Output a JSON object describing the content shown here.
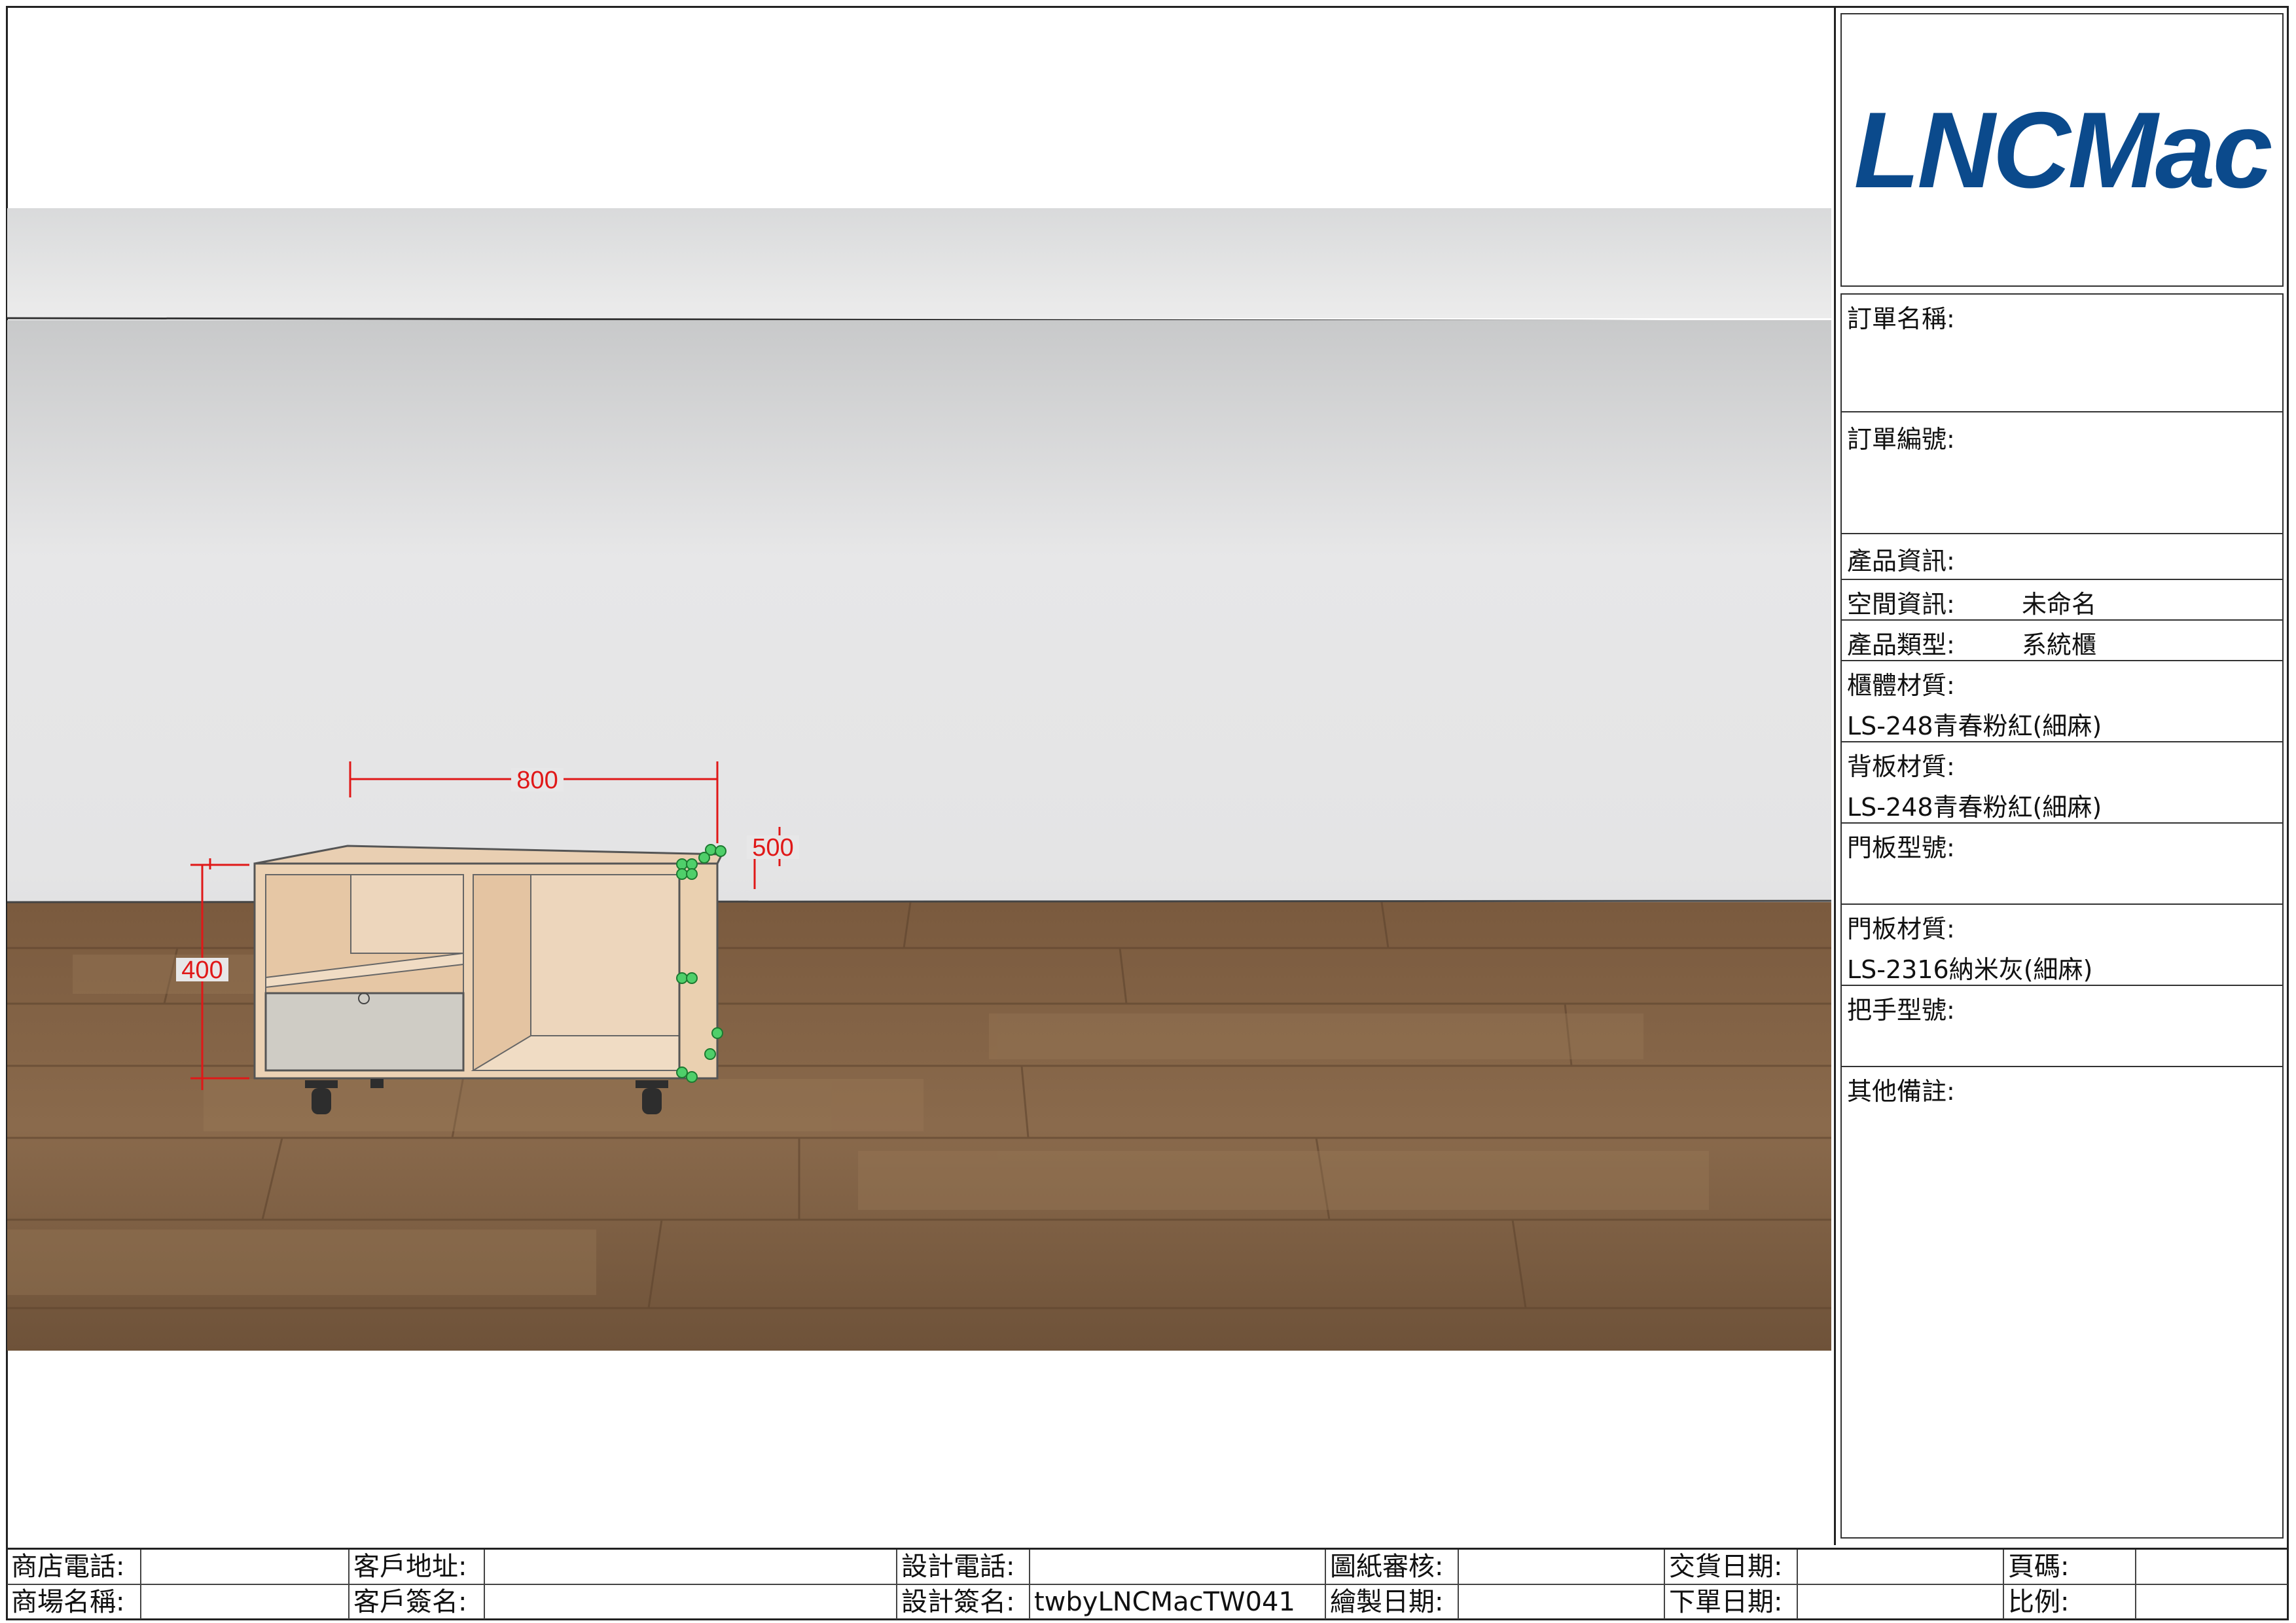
{
  "brand": {
    "logo_text": "LNCMac",
    "color": "#0b4a8c"
  },
  "info_panel": {
    "order_name_label": "訂單名稱:",
    "order_no_label": "訂單編號:",
    "product_info_label": "產品資訊:",
    "space_info_label": "空間資訊:",
    "space_info_value": "未命名",
    "product_type_label": "產品類型:",
    "product_type_value": "系統櫃",
    "cabinet_material_label": "櫃體材質:",
    "cabinet_material_value": "LS-248青春粉紅(細麻)",
    "backboard_material_label": "背板材質:",
    "backboard_material_value": "LS-248青春粉紅(細麻)",
    "door_model_label": "門板型號:",
    "door_material_label": "門板材質:",
    "door_material_value": "LS-2316納米灰(細麻)",
    "handle_model_label": "把手型號:",
    "other_notes_label": "其他備註:"
  },
  "dimensions": {
    "width": "800",
    "depth": "500",
    "height": "400"
  },
  "footer": {
    "store_phone": "商店電話:",
    "customer_address": "客戶地址:",
    "design_phone": "設計電話:",
    "drawing_review": "圖紙審核:",
    "delivery_date": "交貨日期:",
    "page_no": "頁碼:",
    "mall_name": "商場名稱:",
    "customer_signature": "客戶簽名:",
    "designer_signature": "設計簽名:",
    "designer_signature_value": "twbyLNCMacTW041",
    "drawing_date": "繪製日期:",
    "order_date": "下單日期:",
    "scale": "比例:"
  }
}
